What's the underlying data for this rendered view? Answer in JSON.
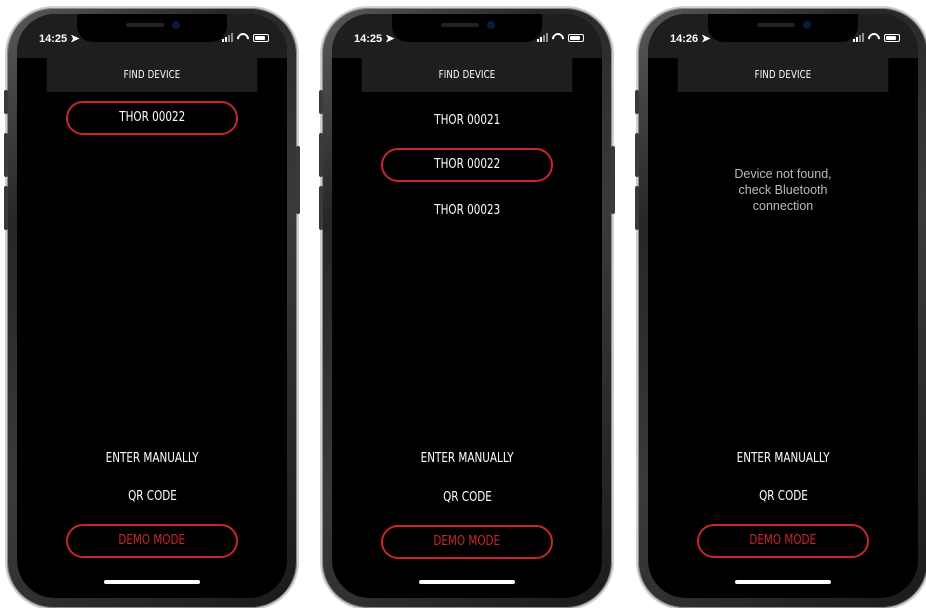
{
  "screens": [
    {
      "time": "14:25",
      "title": "FIND DEVICE",
      "devices": [
        {
          "label": "THOR 00022",
          "selected": true
        }
      ],
      "message": "",
      "enter_manually": "ENTER MANUALLY",
      "qr_code": "QR CODE",
      "demo_mode": "DEMO MODE"
    },
    {
      "time": "14:25",
      "title": "FIND DEVICE",
      "devices": [
        {
          "label": "THOR 00021",
          "selected": false
        },
        {
          "label": "THOR 00022",
          "selected": true
        },
        {
          "label": "THOR 00023",
          "selected": false
        }
      ],
      "message": "",
      "enter_manually": "ENTER MANUALLY",
      "qr_code": "QR CODE",
      "demo_mode": "DEMO MODE"
    },
    {
      "time": "14:26",
      "title": "FIND DEVICE",
      "devices": [],
      "message": "Device not found, check Bluetooth connection",
      "enter_manually": "ENTER MANUALLY",
      "qr_code": "QR CODE",
      "demo_mode": "DEMO MODE"
    }
  ],
  "colors": {
    "accent": "#c8262c",
    "background": "#000000",
    "header": "#1e1e1e"
  },
  "icons": [
    "location-arrow-icon",
    "signal-icon",
    "wifi-icon",
    "battery-icon"
  ]
}
